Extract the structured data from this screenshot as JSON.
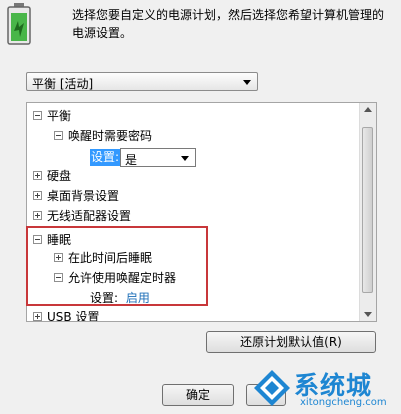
{
  "intro_text": "选择您要自定义的电源计划，然后选择您希望计算机管理的电源设置。",
  "plan_select": {
    "value": "平衡 [活动]"
  },
  "tree": {
    "items": [
      {
        "label": "平衡",
        "expanded": true
      },
      {
        "label": "唤醒时需要密码",
        "expanded": true
      },
      {
        "label": "硬盘",
        "expanded": false
      },
      {
        "label": "桌面背景设置",
        "expanded": false
      },
      {
        "label": "无线适配器设置",
        "expanded": false
      },
      {
        "label": "睡眠",
        "expanded": true
      },
      {
        "label": "在此时间后睡眠",
        "expanded": false
      },
      {
        "label": "允许使用唤醒定时器",
        "expanded": true
      },
      {
        "label": "USB 设置",
        "expanded": false
      }
    ],
    "password_setting": {
      "label": "设置:",
      "value": "是"
    },
    "wake_timer_setting": {
      "label": "设置:",
      "value": "启用"
    }
  },
  "buttons": {
    "restore": "还原计划默认值(R)",
    "ok": "确定"
  },
  "watermark": {
    "brand": "系统城",
    "url": "xitongcheng.com"
  },
  "colors": {
    "highlight": "#c8373a",
    "selection": "#3399ff",
    "link": "#1e6fb8",
    "brand": "#1e86d2"
  }
}
